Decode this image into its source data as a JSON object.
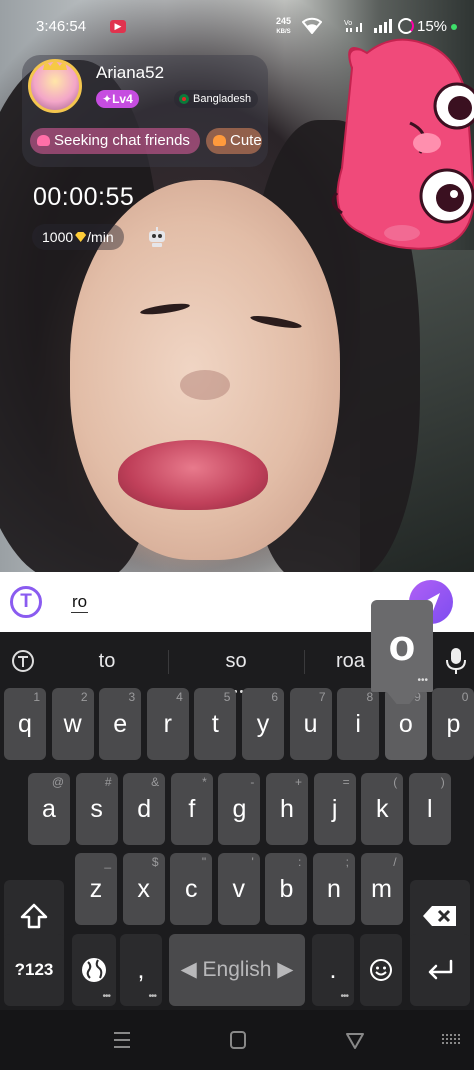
{
  "status_bar": {
    "time": "3:46:54",
    "net_speed": "245",
    "net_unit": "KB/S",
    "battery": "15%"
  },
  "host": {
    "name": "Ariana52",
    "level": "Lv4",
    "country": "Bangladesh",
    "tags": [
      "Seeking chat friends",
      "Cute"
    ]
  },
  "call": {
    "timer": "00:00:55",
    "rate_amount": "1000",
    "rate_unit": "/min"
  },
  "composer": {
    "value": "ro"
  },
  "keyboard": {
    "suggestions": [
      "to",
      "so",
      "roa"
    ],
    "popup_key": "o",
    "rows": [
      [
        [
          "q",
          "1"
        ],
        [
          "w",
          "2"
        ],
        [
          "e",
          "3"
        ],
        [
          "r",
          "4"
        ],
        [
          "t",
          "5"
        ],
        [
          "y",
          "6"
        ],
        [
          "u",
          "7"
        ],
        [
          "i",
          "8"
        ],
        [
          "o",
          "9"
        ],
        [
          "p",
          "0"
        ]
      ],
      [
        [
          "a",
          "@"
        ],
        [
          "s",
          "#"
        ],
        [
          "d",
          "&"
        ],
        [
          "f",
          "*"
        ],
        [
          "g",
          "-"
        ],
        [
          "h",
          "+"
        ],
        [
          "j",
          "="
        ],
        [
          "k",
          "("
        ],
        [
          "l",
          ")"
        ]
      ],
      [
        [
          "z",
          "_"
        ],
        [
          "x",
          "$"
        ],
        [
          "c",
          "\""
        ],
        [
          "v",
          "'"
        ],
        [
          "b",
          ":"
        ],
        [
          "n",
          ";"
        ],
        [
          "m",
          "/"
        ]
      ]
    ],
    "symbols_label": "?123",
    "comma": ",",
    "space_label": "English",
    "period": "."
  },
  "colors": {
    "accent": "#8a5bf0",
    "level_badge": "#c64de0",
    "key": "#4a4a4c",
    "keyboard_bg": "#1c1c1e"
  }
}
